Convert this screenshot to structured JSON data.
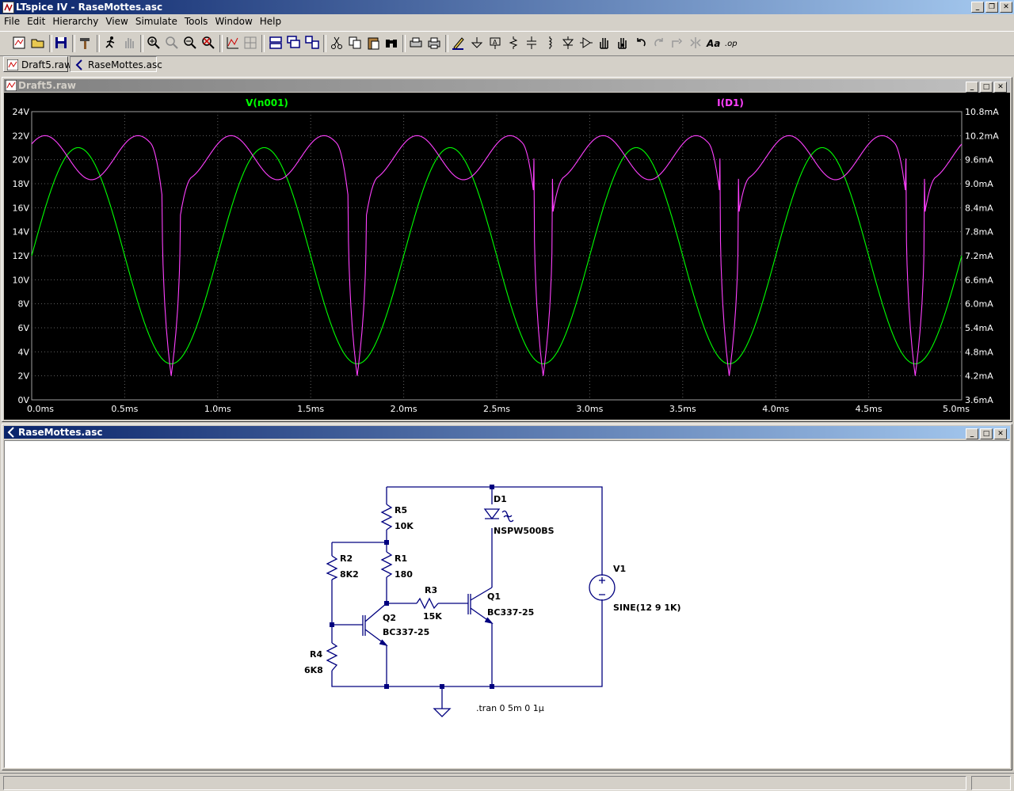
{
  "app": {
    "title": "LTspice IV - RaseMottes.asc"
  },
  "menu": [
    "File",
    "Edit",
    "Hierarchy",
    "View",
    "Simulate",
    "Tools",
    "Window",
    "Help"
  ],
  "tabs": [
    {
      "label": "Draft5.raw"
    },
    {
      "label": "RaseMottes.asc"
    }
  ],
  "plot_window": {
    "title": "Draft5.raw"
  },
  "schematic_window": {
    "title": "RaseMottes.asc"
  },
  "colors": {
    "voltage_trace": "#00ff00",
    "current_trace": "#ff40ff",
    "grid": "#606060",
    "axis_text": "#ffffff"
  },
  "chart_data": {
    "type": "line",
    "x": {
      "label": "",
      "range": [
        0,
        5
      ],
      "unit": "ms",
      "ticks": [
        "0.0ms",
        "0.5ms",
        "1.0ms",
        "1.5ms",
        "2.0ms",
        "2.5ms",
        "3.0ms",
        "3.5ms",
        "4.0ms",
        "4.5ms",
        "5.0ms"
      ]
    },
    "y_left": {
      "range": [
        0,
        24
      ],
      "ticks": [
        "0V",
        "2V",
        "4V",
        "6V",
        "8V",
        "10V",
        "12V",
        "14V",
        "16V",
        "18V",
        "20V",
        "22V",
        "24V"
      ]
    },
    "y_right": {
      "range": [
        3.6,
        10.8
      ],
      "ticks": [
        "3.6mA",
        "4.2mA",
        "4.8mA",
        "5.4mA",
        "6.0mA",
        "6.6mA",
        "7.2mA",
        "7.8mA",
        "8.4mA",
        "9.0mA",
        "9.6mA",
        "10.2mA",
        "10.8mA"
      ]
    },
    "grid": true,
    "series": [
      {
        "name": "V(n001)",
        "axis": "left",
        "function": "12 + 9*sin(2*pi*1k*t)",
        "offset": 12,
        "amplitude": 9,
        "frequency_khz": 1
      },
      {
        "name": "I(D1)",
        "axis": "right",
        "min_ma": 4.2,
        "max_ma": 10.2,
        "dip_times_ms": [
          0.75,
          1.75,
          2.75,
          3.75,
          4.75
        ]
      }
    ]
  },
  "schematic": {
    "components": [
      {
        "ref": "R5",
        "value": "10K"
      },
      {
        "ref": "R1",
        "value": "180"
      },
      {
        "ref": "R2",
        "value": "8K2"
      },
      {
        "ref": "R4",
        "value": "6K8"
      },
      {
        "ref": "R3",
        "value": "15K"
      },
      {
        "ref": "Q2",
        "value": "BC337-25"
      },
      {
        "ref": "Q1",
        "value": "BC337-25"
      },
      {
        "ref": "D1",
        "value": "NSPW500BS"
      },
      {
        "ref": "V1",
        "value": "SINE(12 9 1K)"
      }
    ],
    "directive": ".tran 0 5m 0 1µ"
  }
}
